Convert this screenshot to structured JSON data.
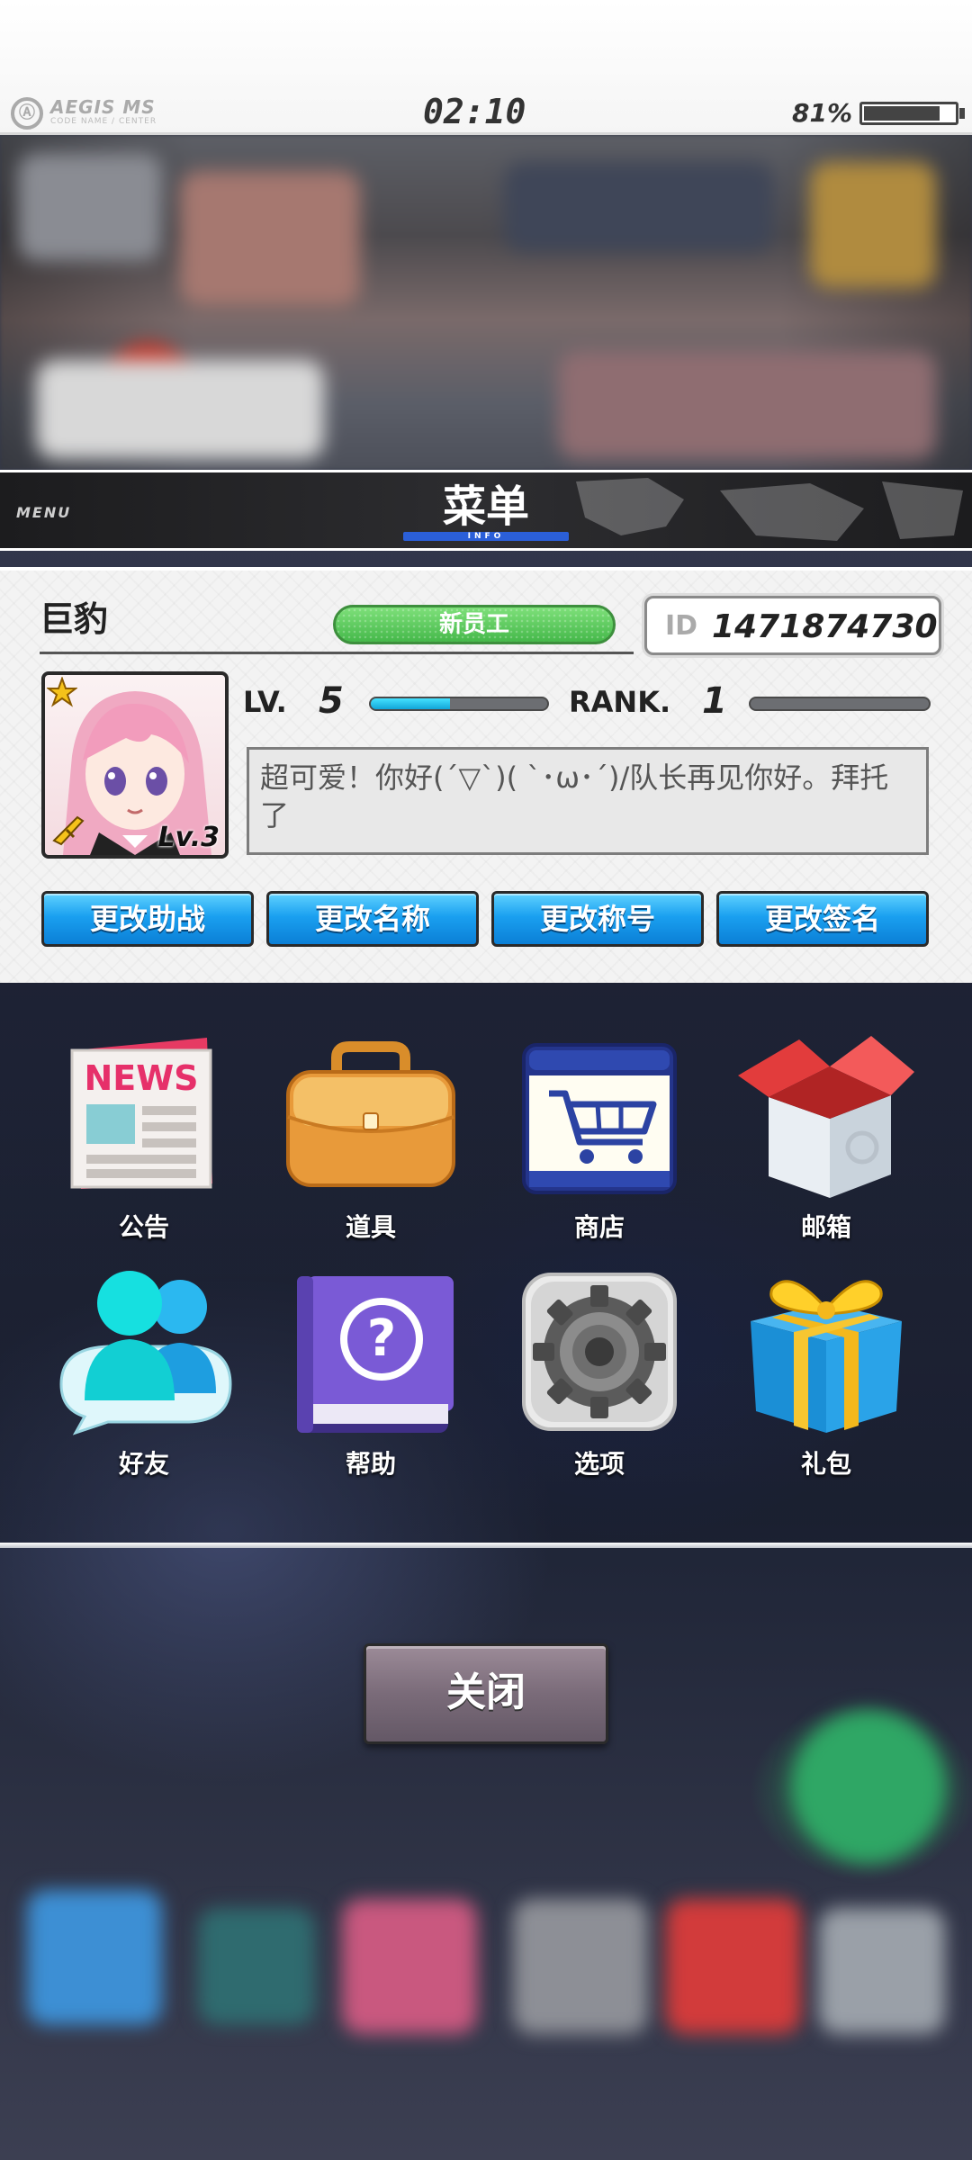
{
  "status_bar": {
    "brand": "AEGIS MS",
    "brand_sub": "CODE NAME / CENTER",
    "time": "02:10",
    "battery_percent": "81%",
    "battery_level": 0.81
  },
  "menu": {
    "small_label": "MENU",
    "title": "菜单",
    "subtitle": "INFO"
  },
  "profile": {
    "name": "巨豹",
    "title_badge": "新员工",
    "id_label": "ID",
    "id_value": "1471874730",
    "avatar_level": "Lv.3",
    "level_label": "LV.",
    "level_value": "5",
    "level_progress": 0.45,
    "rank_label": "RANK.",
    "rank_value": "1",
    "rank_progress": 0.0,
    "signature": "超可爱！你好(´▽`)( `･ω･´)/队长再见你好。拜托了",
    "buttons": [
      "更改助战",
      "更改名称",
      "更改称号",
      "更改签名"
    ]
  },
  "grid": {
    "items": [
      {
        "label": "公告",
        "icon": "news-icon"
      },
      {
        "label": "道具",
        "icon": "briefcase-icon"
      },
      {
        "label": "商店",
        "icon": "shopping-cart-icon"
      },
      {
        "label": "邮箱",
        "icon": "mailbox-icon"
      },
      {
        "label": "好友",
        "icon": "friends-icon"
      },
      {
        "label": "帮助",
        "icon": "help-book-icon"
      },
      {
        "label": "选项",
        "icon": "gear-icon"
      },
      {
        "label": "礼包",
        "icon": "gift-icon"
      }
    ],
    "news_icon_text": "NEWS"
  },
  "close_button": "关闭",
  "colors": {
    "accent_blue": "#1aa0f0",
    "title_green": "#45b84a",
    "level_bar": "#12a5d8",
    "menu_underline": "#2b5fd8"
  }
}
